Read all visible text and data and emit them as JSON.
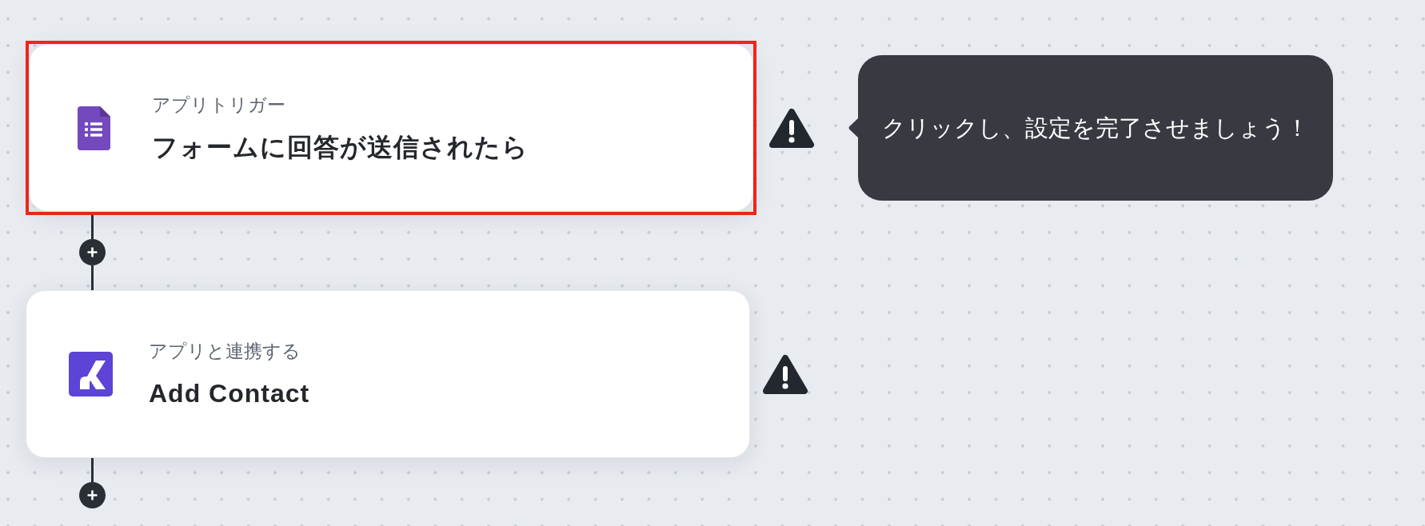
{
  "steps": [
    {
      "kind": "trigger",
      "label": "アプリトリガー",
      "title": "フォームに回答が送信されたら",
      "highlighted": true,
      "warning": true,
      "tooltip": "クリックし、設定を完了させましょう！"
    },
    {
      "kind": "action",
      "label": "アプリと連携する",
      "title": "Add Contact",
      "highlighted": false,
      "warning": true
    }
  ]
}
